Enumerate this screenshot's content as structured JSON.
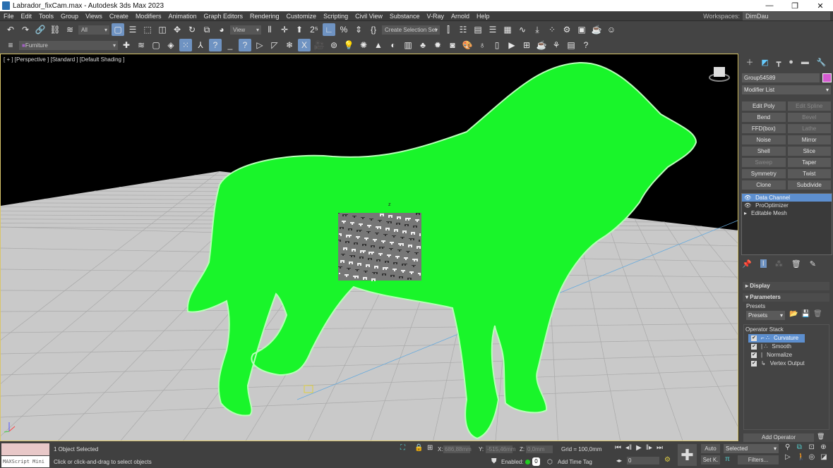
{
  "window": {
    "title": "Labrador_fixCam.max - Autodesk 3ds Max 2023",
    "minimize": "—",
    "maximize": "❐",
    "close": "✕"
  },
  "menu": [
    "File",
    "Edit",
    "Tools",
    "Group",
    "Views",
    "Create",
    "Modifiers",
    "Animation",
    "Graph Editors",
    "Rendering",
    "Customize",
    "Scripting",
    "Civil View",
    "Substance",
    "V-Ray",
    "Arnold",
    "Help"
  ],
  "workspaces": {
    "label": "Workspaces:",
    "value": "DimDau"
  },
  "toolbar": {
    "selection_filter": "All",
    "ref_coord": "View",
    "selection_set": "Create Selection Set",
    "layer": "Furniture"
  },
  "viewport": {
    "label": "[ + ] [Perspective ] [Standard ] [Default Shading ]",
    "gizmo_label": "z"
  },
  "command_panel": {
    "object_name": "Group54589",
    "object_color": "#d45ad0",
    "modifier_list": "Modifier List",
    "modifier_buttons": [
      {
        "label": "Edit Poly",
        "enabled": true
      },
      {
        "label": "Edit Spline",
        "enabled": false
      },
      {
        "label": "Bend",
        "enabled": true
      },
      {
        "label": "Bevel",
        "enabled": false
      },
      {
        "label": "FFD(box)",
        "enabled": true
      },
      {
        "label": "Lathe",
        "enabled": false
      },
      {
        "label": "Noise",
        "enabled": true
      },
      {
        "label": "Mirror",
        "enabled": true
      },
      {
        "label": "Shell",
        "enabled": true
      },
      {
        "label": "Slice",
        "enabled": true
      },
      {
        "label": "Sweep",
        "enabled": false
      },
      {
        "label": "Taper",
        "enabled": true
      },
      {
        "label": "Symmetry",
        "enabled": true
      },
      {
        "label": "Twist",
        "enabled": true
      },
      {
        "label": "Clone",
        "enabled": true
      },
      {
        "label": "Subdivide",
        "enabled": true
      }
    ],
    "stack": [
      {
        "label": "Data Channel",
        "selected": true
      },
      {
        "label": "ProOptimizer",
        "selected": false
      },
      {
        "label": "Editable Mesh",
        "selected": false
      }
    ],
    "rollouts": {
      "display": "Display",
      "parameters": "Parameters"
    },
    "presets_label": "Presets",
    "presets_value": "Presets",
    "operator_stack_label": "Operator Stack",
    "operators": [
      {
        "label": "Curvature",
        "prefix": "⌐ ∴",
        "selected": true
      },
      {
        "label": "Smooth",
        "prefix": "| ∴",
        "selected": false
      },
      {
        "label": "Normalize",
        "prefix": "|",
        "selected": false
      },
      {
        "label": "Vertex Output",
        "prefix": "↳",
        "selected": false
      }
    ],
    "add_operator": "Add Operator"
  },
  "status": {
    "maxscript": "MAXScript Mini",
    "selected": "1 Object Selected",
    "prompt": "Click or click-and-drag to select objects",
    "x_label": "X:",
    "x": "686,88mm",
    "y_label": "Y:",
    "y": "-515,46mm",
    "z_label": "Z:",
    "z": "0,0mm",
    "grid": "Grid = 100,0mm",
    "enabled_label": "Enabled:",
    "enabled_count": "0",
    "add_time_tag": "Add Time Tag",
    "frame": "0",
    "auto": "Auto",
    "setk": "Set K.",
    "key_filter": "Selected",
    "filters": "Filters..."
  },
  "colors": {
    "mesh": "#19f52a",
    "selection": "#5d8fcf",
    "ground": "#c9c9c9"
  }
}
